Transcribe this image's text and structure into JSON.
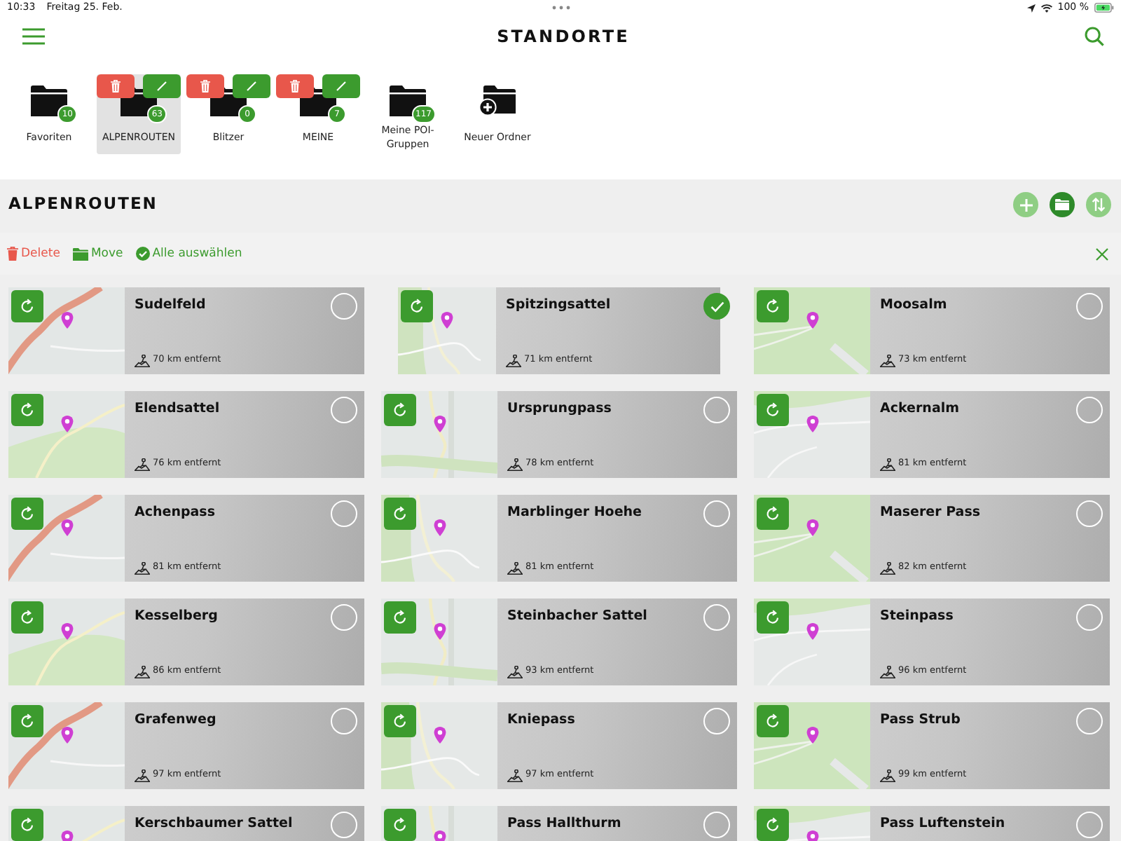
{
  "status_bar": {
    "time": "10:33",
    "date": "Freitag 25. Feb.",
    "battery": "100 %"
  },
  "header": {
    "title": "STANDORTE"
  },
  "folders": [
    {
      "kind": "folder",
      "label": "Favoriten",
      "count": "10",
      "selected": false,
      "editable": false
    },
    {
      "kind": "folder",
      "label": "ALPENROUTEN",
      "count": "63",
      "selected": true,
      "editable": true
    },
    {
      "kind": "folder",
      "label": "Blitzer",
      "count": "0",
      "selected": false,
      "editable": true
    },
    {
      "kind": "folder",
      "label": "MEINE",
      "count": "7",
      "selected": false,
      "editable": true
    },
    {
      "kind": "folder",
      "label": "Meine POI-Gruppen",
      "count": "117",
      "selected": false,
      "editable": false
    },
    {
      "kind": "new",
      "label": "Neuer Ordner",
      "selected": false,
      "editable": false
    }
  ],
  "section": {
    "title": "ALPENROUTEN"
  },
  "actions": [
    {
      "kind": "delete",
      "label": "Delete"
    },
    {
      "kind": "move",
      "label": "Move"
    },
    {
      "kind": "select_all",
      "label": "Alle auswählen"
    }
  ],
  "locations": [
    {
      "name": "Sudelfeld",
      "distance": "70 km entfernt",
      "selected": false
    },
    {
      "name": "Spitzingsattel",
      "distance": "71 km entfernt",
      "selected": true
    },
    {
      "name": "Moosalm",
      "distance": "73 km entfernt",
      "selected": false
    },
    {
      "name": "Elendsattel",
      "distance": "76 km entfernt",
      "selected": false
    },
    {
      "name": "Ursprungpass",
      "distance": "78 km entfernt",
      "selected": false
    },
    {
      "name": "Ackernalm",
      "distance": "81 km entfernt",
      "selected": false
    },
    {
      "name": "Achenpass",
      "distance": "81 km entfernt",
      "selected": false
    },
    {
      "name": "Marblinger Hoehe",
      "distance": "81 km entfernt",
      "selected": false
    },
    {
      "name": "Maserer Pass",
      "distance": "82 km entfernt",
      "selected": false
    },
    {
      "name": "Kesselberg",
      "distance": "86 km entfernt",
      "selected": false
    },
    {
      "name": "Steinbacher Sattel",
      "distance": "93 km entfernt",
      "selected": false
    },
    {
      "name": "Steinpass",
      "distance": "96 km entfernt",
      "selected": false
    },
    {
      "name": "Grafenweg",
      "distance": "97 km entfernt",
      "selected": false
    },
    {
      "name": "Kniepass",
      "distance": "97 km entfernt",
      "selected": false
    },
    {
      "name": "Pass Strub",
      "distance": "99 km entfernt",
      "selected": false
    },
    {
      "name": "Kerschbaumer Sattel",
      "selected": false
    },
    {
      "name": "Pass Hallthurm",
      "selected": false
    },
    {
      "name": "Pass Luftenstein",
      "selected": false
    }
  ]
}
